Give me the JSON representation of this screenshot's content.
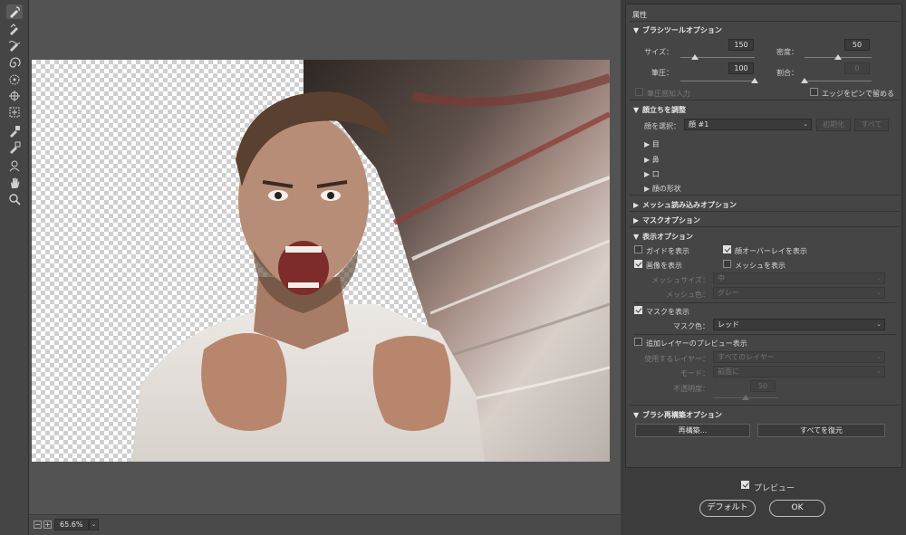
{
  "zoom": {
    "minus": "−",
    "plus": "+",
    "level": "65.6%",
    "dropdown": "⌄"
  },
  "panel": {
    "title": "属性",
    "brush_tool_options": {
      "title": "ブラシツールオプション",
      "size_label": "サイズ：",
      "size_value": "150",
      "density_label": "密度：",
      "density_value": "50",
      "pressure_label": "筆圧：",
      "pressure_value": "100",
      "rate_label": "割合：",
      "rate_value": "0",
      "stylus_label": "筆圧感知入力",
      "pin_edges_label": "エッジをピンで留める"
    },
    "face_aware": {
      "title": "顔立ちを調整",
      "select_face_label": "顔を選択：",
      "select_face_value": "顔 #1",
      "reset_label": "初期化",
      "all_label": "すべて",
      "items": [
        "目",
        "鼻",
        "口",
        "顔の形状"
      ]
    },
    "load_mesh": {
      "title": "メッシュ読み込みオプション"
    },
    "mask_options": {
      "title": "マスクオプション"
    },
    "view_options": {
      "title": "表示オプション",
      "show_guides": "ガイドを表示",
      "show_face_overlay": "顔オーバーレイを表示",
      "show_image": "画像を表示",
      "show_mesh": "メッシュを表示",
      "mesh_size_label": "メッシュサイズ：",
      "mesh_size_value": "中",
      "mesh_color_label": "メッシュ色：",
      "mesh_color_value": "グレー",
      "show_mask": "マスクを表示",
      "mask_color_label": "マスク色：",
      "mask_color_value": "レッド",
      "show_backdrop": "追加レイヤーのプレビュー表示",
      "use_layer_label": "使用するレイヤー：",
      "use_layer_value": "すべてのレイヤー",
      "mode_label": "モード：",
      "mode_value": "前面に",
      "opacity_label": "不透明度：",
      "opacity_value": "50"
    },
    "brush_reconstruct": {
      "title": "ブラシ再構築オプション",
      "reconstruct_label": "再構築...",
      "restore_all_label": "すべてを復元"
    }
  },
  "footer": {
    "preview_label": "プレビュー",
    "default_label": "デフォルト",
    "ok_label": "OK"
  },
  "colors": {
    "accent": "#e2e2e2",
    "panel_bg": "#454545",
    "canvas_bg": "#535353"
  },
  "tools": [
    "forward-warp-icon",
    "reconstruct-icon",
    "smooth-icon",
    "twirl-icon",
    "pucker-icon",
    "bloat-icon",
    "push-left-icon",
    "freeze-mask-icon",
    "thaw-mask-icon",
    "face-tool-icon",
    "hand-icon",
    "zoom-icon"
  ]
}
